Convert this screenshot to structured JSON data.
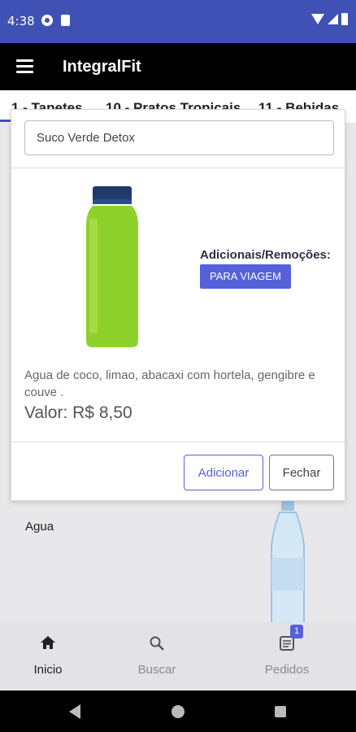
{
  "status_bar": {
    "time": "4:38"
  },
  "app_bar": {
    "title": "IntegralFit"
  },
  "category_tabs": [
    "1 - Tapetes",
    "10 - Pratos Tropicais",
    "11 - Bebidas"
  ],
  "background_list": {
    "item_name": "Agua"
  },
  "modal": {
    "product_name": "Suco Verde Detox",
    "addons_title": "Adicionais/Remoções:",
    "addon_chip": "PARA VIAGEM",
    "description": "Agua de coco, limao, abacaxi com hortela, gengibre e couve .",
    "price": "Valor: R$ 8,50",
    "add_button": "Adicionar",
    "close_button": "Fechar"
  },
  "bottom_nav": {
    "items": [
      {
        "label": "Inicio",
        "icon": "home-icon",
        "active": true
      },
      {
        "label": "Buscar",
        "icon": "search-icon",
        "active": false
      },
      {
        "label": "Pedidos",
        "icon": "orders-icon",
        "active": false,
        "badge": "1"
      }
    ]
  },
  "colors": {
    "status_bar": "#3f51b5",
    "app_bar": "#000000",
    "accent": "#5561d9"
  }
}
